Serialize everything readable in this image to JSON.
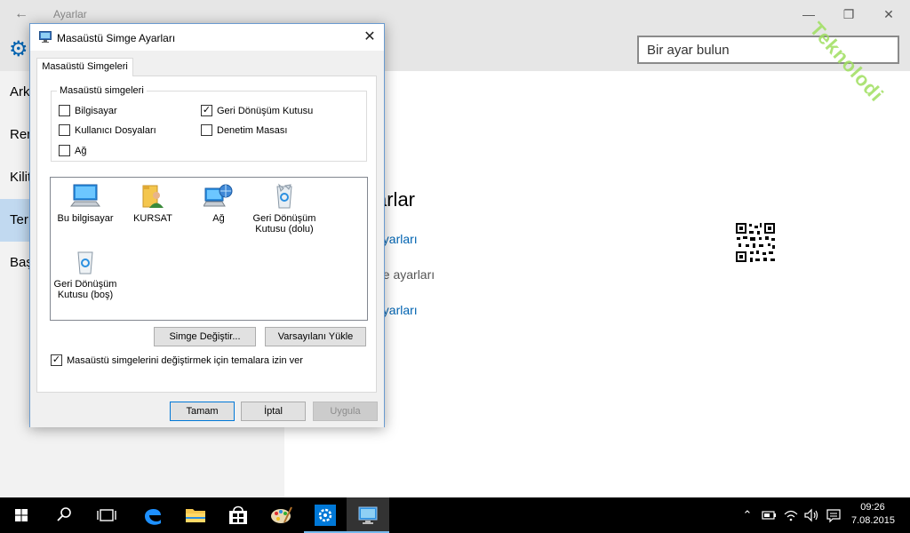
{
  "settings": {
    "title": "Ayarlar",
    "search_placeholder": "Bir ayar bulun",
    "nav": [
      "Ark",
      "Ren",
      "Kilit",
      "Ter",
      "Baş"
    ],
    "nav_selected": 3,
    "content_title": "arlar",
    "links": [
      {
        "text": "ayarları",
        "color": "#0063b1"
      },
      {
        "text": "ge ayarları",
        "color": "#555555"
      },
      {
        "text": "ayarları",
        "color": "#0063b1"
      }
    ]
  },
  "watermark": "Teknolodi",
  "dialog": {
    "title": "Masaüstü Simge Ayarları",
    "tab": "Masaüstü Simgeleri",
    "group_label": "Masaüstü simgeleri",
    "checkboxes": [
      {
        "label": "Bilgisayar",
        "checked": false
      },
      {
        "label": "Geri Dönüşüm Kutusu",
        "checked": true
      },
      {
        "label": "Kullanıcı Dosyaları",
        "checked": false
      },
      {
        "label": "Denetim Masası",
        "checked": false
      },
      {
        "label": "Ağ",
        "checked": false
      }
    ],
    "icons": [
      {
        "label": "Bu bilgisayar",
        "icon": "computer-icon"
      },
      {
        "label": "KURSAT",
        "icon": "user-folder-icon"
      },
      {
        "label": "Ağ",
        "icon": "network-icon"
      },
      {
        "label": "Geri Dönüşüm Kutusu (dolu)",
        "icon": "recycle-bin-full-icon"
      },
      {
        "label": "Geri Dönüşüm Kutusu (boş)",
        "icon": "recycle-bin-empty-icon"
      }
    ],
    "change_icon_button": "Simge Değiştir...",
    "restore_default_button": "Varsayılanı Yükle",
    "allow_themes_label": "Masaüstü simgelerini değiştirmek için temalara izin ver",
    "allow_themes_checked": true,
    "ok_button": "Tamam",
    "cancel_button": "İptal",
    "apply_button": "Uygula"
  },
  "taskbar": {
    "time": "09:26",
    "date": "7.08.2015"
  },
  "colors": {
    "accent": "#0063b1",
    "taskbar": "#000000",
    "nav_selected": "#c1d9f0"
  }
}
